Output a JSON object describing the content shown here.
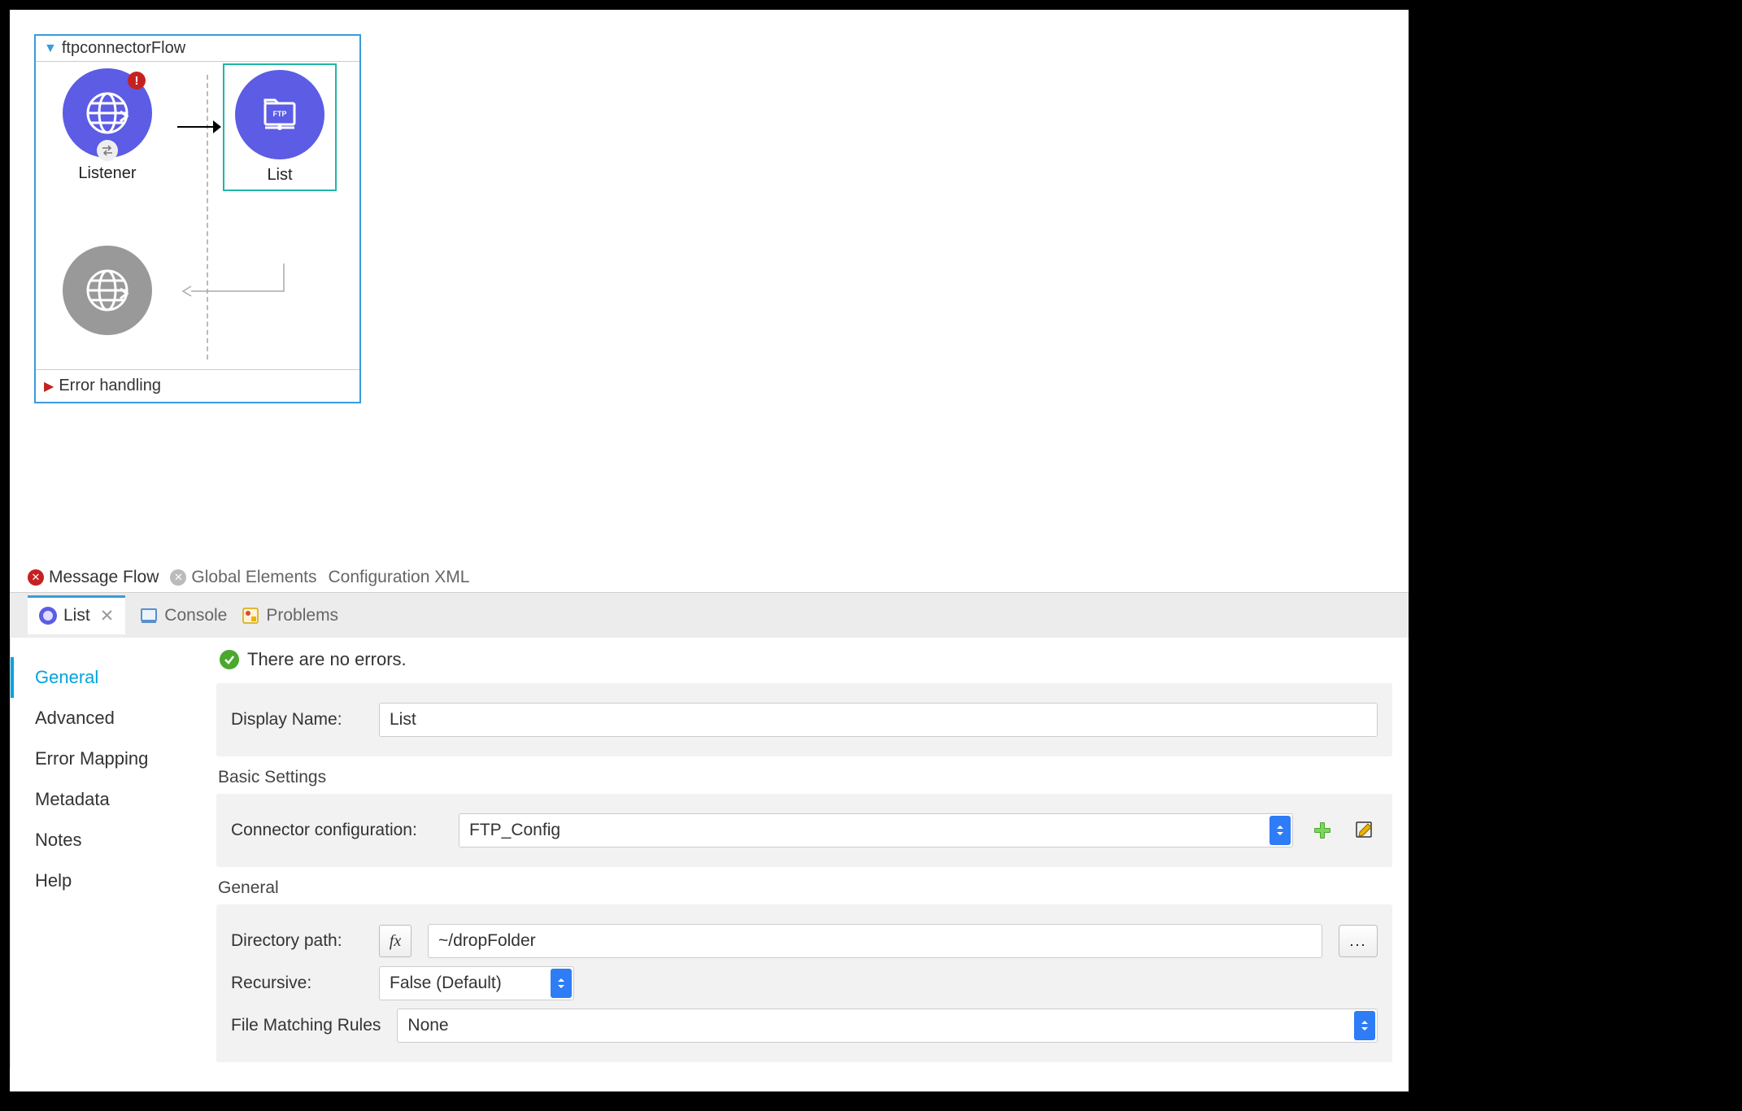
{
  "flow": {
    "title": "ftpconnectorFlow",
    "nodes": {
      "listener_label": "Listener",
      "list_label": "List"
    },
    "footer": "Error handling"
  },
  "editorTabs": {
    "messageFlow": "Message Flow",
    "globalElements": "Global Elements",
    "configXml": "Configuration XML"
  },
  "panelTabs": {
    "list": "List",
    "console": "Console",
    "problems": "Problems"
  },
  "sideNav": {
    "general": "General",
    "advanced": "Advanced",
    "errorMapping": "Error Mapping",
    "metadata": "Metadata",
    "notes": "Notes",
    "help": "Help"
  },
  "status": {
    "msg": "There are no errors."
  },
  "form": {
    "displayName_label": "Display Name:",
    "displayName_value": "List",
    "basicSettings_title": "Basic Settings",
    "connectorConfig_label": "Connector configuration:",
    "connectorConfig_value": "FTP_Config",
    "general_title": "General",
    "directoryPath_label": "Directory path:",
    "directoryPath_value": "~/dropFolder",
    "recursive_label": "Recursive:",
    "recursive_value": "False (Default)",
    "fileMatching_label": "File Matching Rules",
    "fileMatching_value": "None",
    "fx_label": "fx",
    "dots_label": "..."
  }
}
